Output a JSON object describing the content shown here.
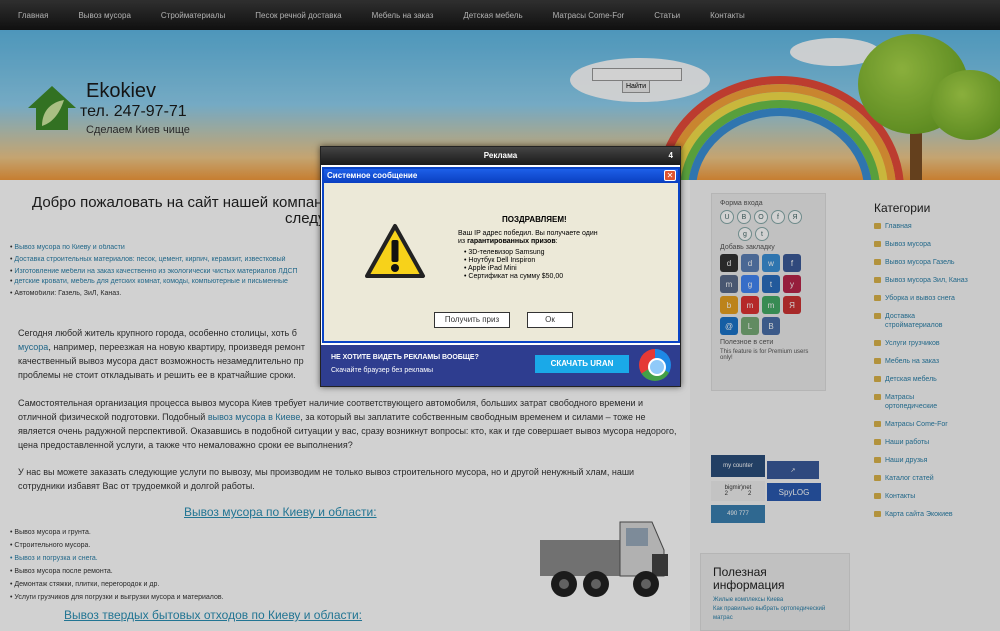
{
  "nav": [
    "Главная",
    "Вывоз мусора",
    "Стройматериалы",
    "Песок речной доставка",
    "Мебель на заказ",
    "Детская мебель",
    "Матрасы Come-For",
    "Статьи",
    "Контакты"
  ],
  "header": {
    "brand": "Ekokiev",
    "phone": "тел. 247-97-71",
    "slogan": "Сделаем Киев чище",
    "search_button": "Найти"
  },
  "main": {
    "welcome_line1": "Добро пожаловать на сайт нашей компани",
    "welcome_line2": "следу",
    "links": [
      "Вывоз мусора по Киеву и области",
      "Доставка строительных материалов: песок, цемент, кирпич, керамзит, известковый",
      "Изготовление мебели на заказ качественно из экологически чистых материалов ЛДСП",
      "детские кровати, мебель для детских комнат, комоды, компьютерные и письменные"
    ],
    "autos": "Автомобили: Газель, ЗиЛ, Каназ.",
    "para1": "Сегодня любой житель крупного города, особенно столицы, хоть б",
    "para1_link": "мусора",
    "para1_b": ", например, переезжая на новую квартиру, произведя ремонт",
    "para1_c": "качественный вывоз мусора даст возможность незамедлительно пр",
    "para1_d": "проблемы не стоит откладывать и решить ее в кратчайшие сроки.",
    "para2_a": "Самостоятельная организация процесса вывоз мусора Киев требует наличие соответствующего автомобиля, больших затрат свободного времени и отличной физической подготовки. Подобный ",
    "para2_link": "вывоз мусора в Киеве",
    "para2_b": ", за который вы заплатите собственным свободным временем и силами – тоже не является очень радужной перспективой. Оказавшись в подобной ситуации у вас, сразу возникнут вопросы: кто, как и где совершает вывоз мусора недорого, цена предоставленной услуги, а также что немаловажно сроки ее выполнения?",
    "para3": "У нас вы можете заказать следующие услуги по вывозу, мы производим не только вывоз строительного мусора, но и другой ненужный хлам, наши сотрудники избавят Вас от трудоемкой и долгой работы.",
    "section_title": "Вывоз мусора по Киеву и области:",
    "services": [
      {
        "text": "Вывоз мусора и грунта.",
        "link": false
      },
      {
        "text": "Строительного мусора.",
        "link": false
      },
      {
        "text": "Вывоз и погрузка и снега.",
        "link": true
      },
      {
        "text": "Вывоз мусора после ремонта.",
        "link": false
      },
      {
        "text": "Демонтаж стяжки, плитки, перегородок и др.",
        "link": false
      },
      {
        "text": "Услуги грузчиков для погрузки и выгрузки мусора и материалов.",
        "link": false
      }
    ],
    "section_title2": "Вывоз твердых бытовых отходов по Киеву и области:"
  },
  "midbar": {
    "login_label": "Форма входа",
    "bookmark_label": "Добавь закладку",
    "popular_label": "Полезное в сети",
    "premium_note": "This feature is for Premium users only!"
  },
  "counters": {
    "mycounter": "my counter",
    "bigmir": "bigmir)net",
    "bigmir_vals": [
      "2",
      "2"
    ],
    "spylog": "SpyLOG",
    "liveinternet": "490 777"
  },
  "info": {
    "title": "Полезная информация",
    "links": [
      "Жилые комплексы Киева",
      "Как правильно выбрать ортопедический",
      "матрас"
    ]
  },
  "categories": {
    "title": "Категории",
    "items": [
      "Главная",
      "Вывоз мусора",
      "Вывоз мусора Газель",
      "Вывоз мусора Зил, Каназ",
      "Уборка и вывоз снега",
      "Доставка стройматериалов",
      "Услуги грузчиков",
      "Мебель на заказ",
      "Детская мебель",
      "Матрасы ортопедические",
      "Матрасы Come-For",
      "Наши работы",
      "Наши друзья",
      "Каталог статей",
      "Контакты",
      "Карта сайта Экокиев"
    ]
  },
  "ad": {
    "title": "Реклама",
    "countdown": "4",
    "dialog_title": "Системное сообщение",
    "congrats": "ПОЗДРАВЛЯЕМ!",
    "msg_a": "Ваш IP адрес победил. Вы получаете один",
    "msg_b": "из ",
    "msg_bold": "гарантированных призов",
    "msg_c": ":",
    "prizes": [
      "3D-телевизор Samsung",
      "Ноутбук Dell Inspiron",
      "Apple iPad Mini",
      "Сертификат на сумму $50,00"
    ],
    "claim_button": "Получить приз",
    "ok_button": "Ок",
    "footer_question": "НЕ ХОТИТЕ ВИДЕТЬ РЕКЛАМЫ ВООБЩЕ?",
    "footer_sub": "Скачайте браузер без рекламы",
    "download_button": "СКАЧАТЬ URAN"
  },
  "colors": {
    "link": "#2a7fa8",
    "nav_bg": "#1a1a1a",
    "dialog_blue": "#0a44c6",
    "ad_footer": "#2e3d8f",
    "download": "#1aa9e8"
  }
}
